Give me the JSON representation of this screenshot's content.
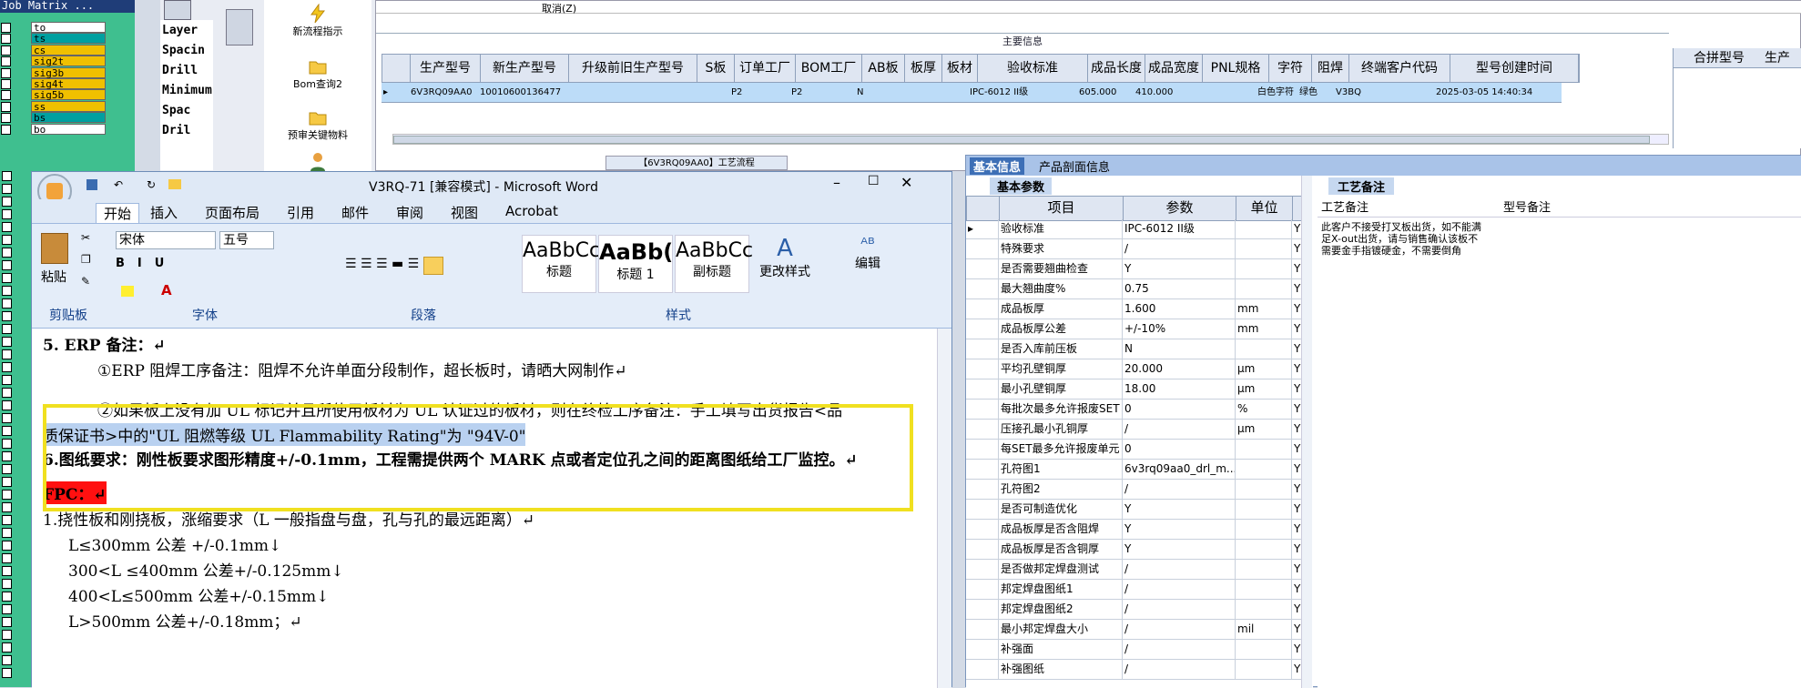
{
  "job_matrix": {
    "title": "Job Matrix ...",
    "layers": [
      {
        "name": "to",
        "color": "#ffffff"
      },
      {
        "name": "ts",
        "color": "#00a0a0"
      },
      {
        "name": "cs",
        "color": "#f0c000"
      },
      {
        "name": "sig2t",
        "color": "#f0c000"
      },
      {
        "name": "sig3b",
        "color": "#f0c000"
      },
      {
        "name": "sig4t",
        "color": "#f0c000"
      },
      {
        "name": "sig5b",
        "color": "#f0c000"
      },
      {
        "name": "ss",
        "color": "#f0c000"
      },
      {
        "name": "bs",
        "color": "#00a0a0"
      },
      {
        "name": "bo",
        "color": "#ffffff"
      }
    ]
  },
  "layer_panel": {
    "items": [
      "Layer",
      "Spacin",
      "Drill",
      "Minimum",
      "Spac",
      "Dril"
    ]
  },
  "tool_buttons": [
    {
      "label": "新流程指示",
      "icon": "lightning-icon"
    },
    {
      "label": "Bom查询2",
      "icon": "folder-icon"
    },
    {
      "label": "预审关键物料",
      "icon": "folder-icon"
    }
  ],
  "top_grid": {
    "menu_item": "取消(Z)",
    "banner": "主要信息",
    "headers": [
      "生产型号",
      "新生产型号",
      "升级前旧生产型号",
      "S板",
      "订单工厂",
      "BOM工厂",
      "AB板",
      "板厚",
      "板材",
      "验收标准",
      "成品长度",
      "成品宽度",
      "PNL规格",
      "字符",
      "阻焊",
      "终端客户代码",
      "型号创建时间"
    ],
    "row": [
      "6V3RQ09AA0",
      "10010600136477",
      "",
      "",
      "P2",
      "P2",
      "N",
      "",
      "",
      "IPC-6012 II级",
      "605.000",
      "410.000",
      "",
      "白色字符",
      "绿色",
      "V3BQ",
      "2025-03-05 14:40:34"
    ],
    "right_headers": [
      "合拼型号",
      "生产"
    ],
    "process_tab": "【6V3RQ09AA0】工艺流程"
  },
  "word": {
    "title": "V3RQ-71 [兼容模式] - Microsoft Word",
    "tabs": [
      "开始",
      "插入",
      "页面布局",
      "引用",
      "邮件",
      "审阅",
      "视图",
      "Acrobat"
    ],
    "font_name": "宋体",
    "font_size": "五号",
    "groups": [
      "剪贴板",
      "字体",
      "段落",
      "样式"
    ],
    "paste_label": "粘贴",
    "styles": [
      {
        "sample": "AaBbCc",
        "label": "标题"
      },
      {
        "sample": "AaBb(",
        "label": "标题 1"
      },
      {
        "sample": "AaBbCc",
        "label": "副标题"
      }
    ],
    "change_styles": "更改样式",
    "edit": "编辑",
    "doc_lines": [
      "5. ERP 备注：↵",
      "①ERP 阻焊工序备注：阻焊不允许单面分段制作，超长板时，请晒大网制作↵",
      "②如果板上没有加 UL 标记并且所使用板材为 UL 认证过的板材，则在终检工序备注：手工填写出货报告<品",
      "质保证书>中的\"UL 阻燃等级 UL Flammability Rating\"为 \"94V-0\"",
      "6.图纸要求：刚性板要求图形精度+/-0.1mm，工程需提供两个 MARK 点或者定位孔之间的距离图纸给工厂监控。↵",
      "FPC：↵",
      "1.挠性板和刚挠板，涨缩要求（L 一般指盘与盘，孔与孔的最远距离）↵",
      "L≤300mm 公差 +/-0.1mm↓",
      "300<L ≤400mm 公差+/-0.125mm↓",
      "400<L≤500mm 公差+/-0.15mm↓",
      "L>500mm 公差+/-0.18mm；↵"
    ]
  },
  "right_panel": {
    "tabs": [
      "基本信息",
      "产品剖面信息"
    ],
    "basic_tab": "基本参数",
    "headers": [
      "项目",
      "参数",
      "单位"
    ],
    "rows": [
      [
        "验收标准",
        "IPC-6012 II级",
        "",
        "Y"
      ],
      [
        "特殊要求",
        "/",
        "",
        "Y"
      ],
      [
        "是否需要翘曲检查",
        "Y",
        "",
        "Y"
      ],
      [
        "最大翘曲度%",
        "0.75",
        "",
        "Y"
      ],
      [
        "成品板厚",
        "1.600",
        "mm",
        "Y"
      ],
      [
        "成品板厚公差",
        "+/-10%",
        "mm",
        "Y"
      ],
      [
        "是否入库前压板",
        "N",
        "",
        "Y"
      ],
      [
        "平均孔壁铜厚",
        "20.000",
        "μm",
        "Y"
      ],
      [
        "最小孔壁铜厚",
        "18.00",
        "μm",
        "Y"
      ],
      [
        "每批次最多允许报废SET",
        "0",
        "%",
        "Y"
      ],
      [
        "压接孔最小孔铜厚",
        "/",
        "μm",
        "Y"
      ],
      [
        "每SET最多允许报废单元",
        "0",
        "",
        "Y"
      ],
      [
        "孔符图1",
        "6v3rq09aa0_drl_m...",
        "",
        "Y"
      ],
      [
        "孔符图2",
        "/",
        "",
        "Y"
      ],
      [
        "是否可制造优化",
        "Y",
        "",
        "Y"
      ],
      [
        "成品板厚是否含阻焊",
        "Y",
        "",
        "Y"
      ],
      [
        "成品板厚是否含铜厚",
        "Y",
        "",
        "Y"
      ],
      [
        "是否做邦定焊盘测试",
        "/",
        "",
        "Y"
      ],
      [
        "邦定焊盘图纸1",
        "/",
        "",
        "Y"
      ],
      [
        "邦定焊盘图纸2",
        "/",
        "",
        "Y"
      ],
      [
        "最小邦定焊盘大小",
        "/",
        "mil",
        "Y"
      ],
      [
        "补强面",
        "/",
        "",
        "Y"
      ],
      [
        "补强图纸",
        "/",
        "",
        "Y"
      ]
    ],
    "notes_tab": "工艺备注",
    "notes_headers": [
      "工艺备注",
      "型号备注"
    ],
    "notes_text": "此客户不接受打叉板出货，如不能满足X-out出货，请与销售确认该板不需要金手指镀硬金，不需要倒角"
  }
}
